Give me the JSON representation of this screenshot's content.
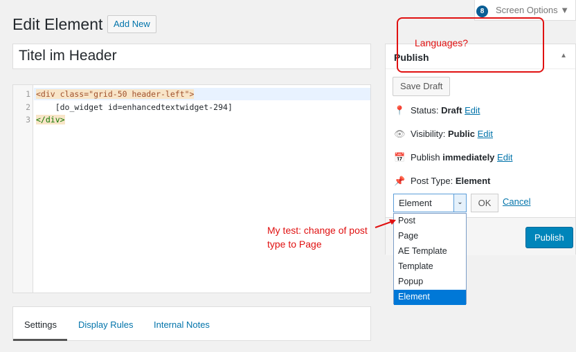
{
  "header": {
    "title": "Edit Element",
    "add_new": "Add New",
    "screen_options": "Screen Options",
    "badge": "8"
  },
  "post_title": "Titel im Header",
  "code": {
    "lines": [
      {
        "n": "1",
        "text": "<div class=\"grid-50 header-left\">"
      },
      {
        "n": "2",
        "text": "    [do_widget id=enhancedtextwidget-294]"
      },
      {
        "n": "3",
        "text": "</div>"
      }
    ]
  },
  "tabs": [
    "Settings",
    "Display Rules",
    "Internal Notes"
  ],
  "publish": {
    "title": "Publish",
    "save_draft": "Save Draft",
    "status_label": "Status:",
    "status_value": "Draft",
    "visibility_label": "Visibility:",
    "visibility_value": "Public",
    "publish_label": "Publish",
    "publish_value": "immediately",
    "post_type_label": "Post Type:",
    "post_type_value": "Element",
    "edit": "Edit",
    "selected": "Element",
    "ok": "OK",
    "cancel": "Cancel",
    "publish_button": "Publish",
    "options": [
      "Post",
      "Page",
      "AE Template",
      "Template",
      "Popup",
      "Element"
    ]
  },
  "annotations": {
    "languages": "Languages?",
    "test_line1": "My test: change of post",
    "test_line2": "type to Page"
  }
}
